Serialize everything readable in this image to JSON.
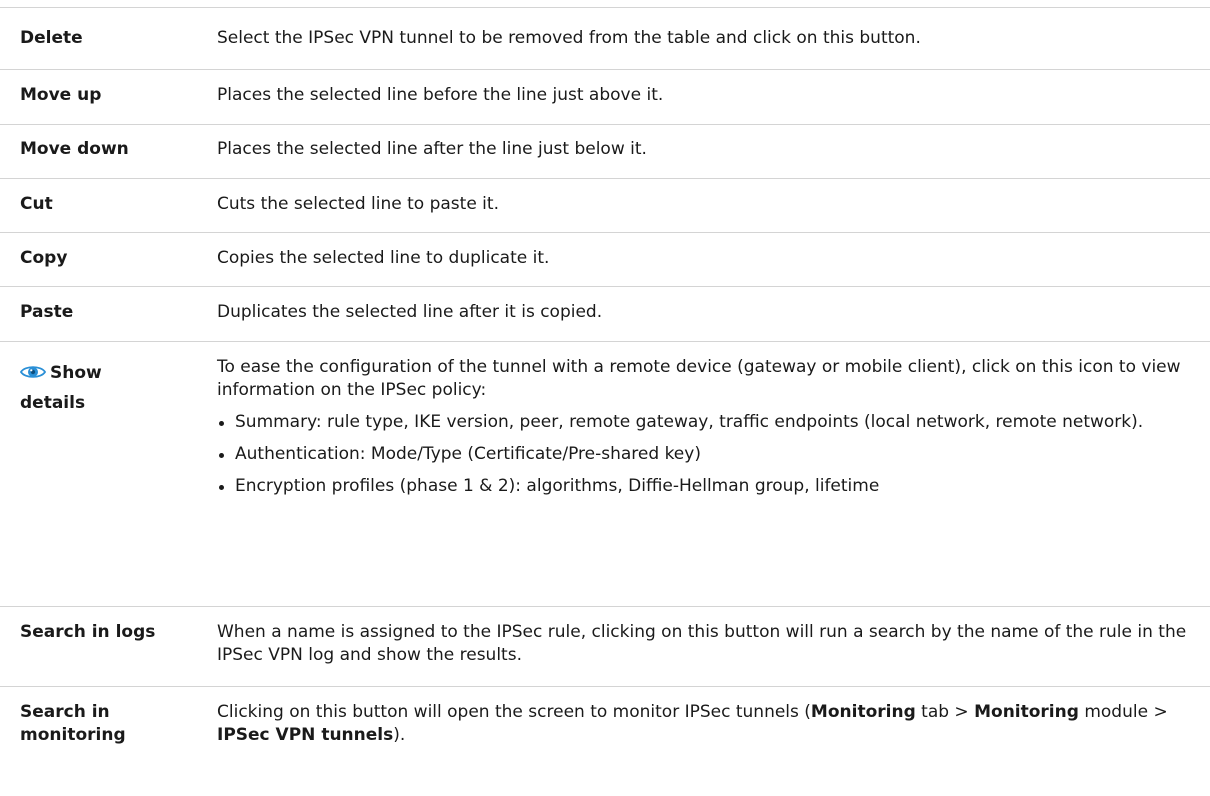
{
  "rows": [
    {
      "term": "Delete",
      "desc": "Select the IPSec VPN tunnel to be removed from the table and click on this button."
    },
    {
      "term": "Move up",
      "desc": "Places the selected line before the line just above it."
    },
    {
      "term": "Move down",
      "desc": "Places the selected line after the line just below it."
    },
    {
      "term": "Cut",
      "desc": "Cuts the selected line to paste it."
    },
    {
      "term": "Copy",
      "desc": "Copies the selected line to duplicate it."
    },
    {
      "term": "Paste",
      "desc": "Duplicates the selected line after it is copied."
    }
  ],
  "show_details": {
    "icon": "eye-icon",
    "icon_color": "#2a8fd6",
    "term_line1": "Show",
    "term_line2": "details",
    "intro": "To ease the configuration of the tunnel with a remote device (gateway or mobile client), click on this icon to view information on the IPSec policy:",
    "bullets": [
      "Summary: rule type, IKE version, peer, remote gateway, traffic endpoints (local network, remote network).",
      "Authentication: Mode/Type (Certificate/Pre-shared key)",
      "Encryption profiles (phase 1 & 2): algorithms, Diffie-Hellman group, lifetime"
    ]
  },
  "search_logs": {
    "term": "Search in logs",
    "desc": "When a name is assigned to the IPSec rule, clicking on this button will run a search by the name of the rule in the IPSec VPN log and show the results."
  },
  "search_monitoring": {
    "term_line1": "Search in",
    "term_line2": "monitoring",
    "desc_part1": "Clicking on this button will open the screen to monitor IPSec tunnels (",
    "desc_bold1": "Monitoring",
    "desc_part2": " tab > ",
    "desc_bold2": "Monitoring",
    "desc_part3": " module > ",
    "desc_bold3": "IPSec VPN tunnels",
    "desc_part4": ")."
  }
}
